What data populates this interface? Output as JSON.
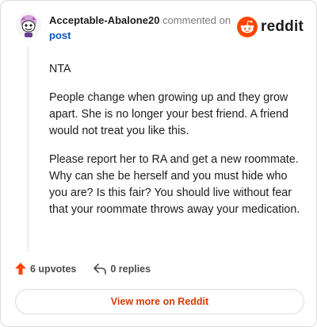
{
  "comment": {
    "username": "Acceptable-Abalone20",
    "action": "commented on",
    "post_link": "post",
    "body": [
      "NTA",
      "People change when growing up and they grow apart. She is no longer your best friend. A friend would not treat you like this.",
      "Please report her to RA and get a new roommate. Why can she be herself and you must hide who you are? Is this fair? You should live without fear that your roommate throws away your medication."
    ]
  },
  "brand": {
    "name": "reddit",
    "icon": "reddit-snoo-icon",
    "color": "#ff4500"
  },
  "stats": {
    "upvotes": "6 upvotes",
    "replies": "0 replies",
    "upvote_icon": "upvote-arrow-icon",
    "reply_icon": "reply-arrow-icon",
    "upvote_color": "#ff4500"
  },
  "cta": {
    "label": "View more on Reddit",
    "color": "#d93a00"
  }
}
